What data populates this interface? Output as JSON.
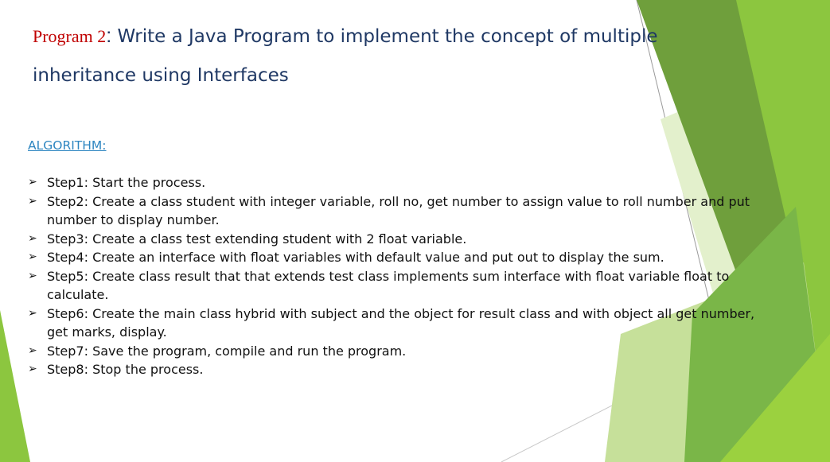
{
  "title": {
    "prefix": "Program 2",
    "colon": ":",
    "text": " Write a Java Program to implement the concept of multiple inheritance using Interfaces"
  },
  "algorithm": {
    "heading": "ALGORITHM:",
    "bullet_glyph": "➢",
    "steps": [
      "Step1:  Start the process.",
      "Step2: Create a class student with integer variable, roll no, get number to assign value to roll number and put number to display number.",
      "Step3: Create a class test extending student with 2 float variable.",
      "Step4: Create an interface with float variables with default value and put out to display the sum.",
      "Step5: Create class result that that extends test class implements sum interface with float variable float to calculate.",
      "Step6: Create the main class hybrid with subject and the object for result class and with object all get number, get marks, display.",
      "Step7: Save the program, compile and run the program.",
      "Step8: Stop the process."
    ]
  },
  "colors": {
    "title_prefix": "#c00000",
    "title_text": "#1f3864",
    "heading": "#2e86c1",
    "green_dark": "#6aa33a",
    "green_mid": "#8cc63f",
    "green_light": "#d9ecc0"
  }
}
